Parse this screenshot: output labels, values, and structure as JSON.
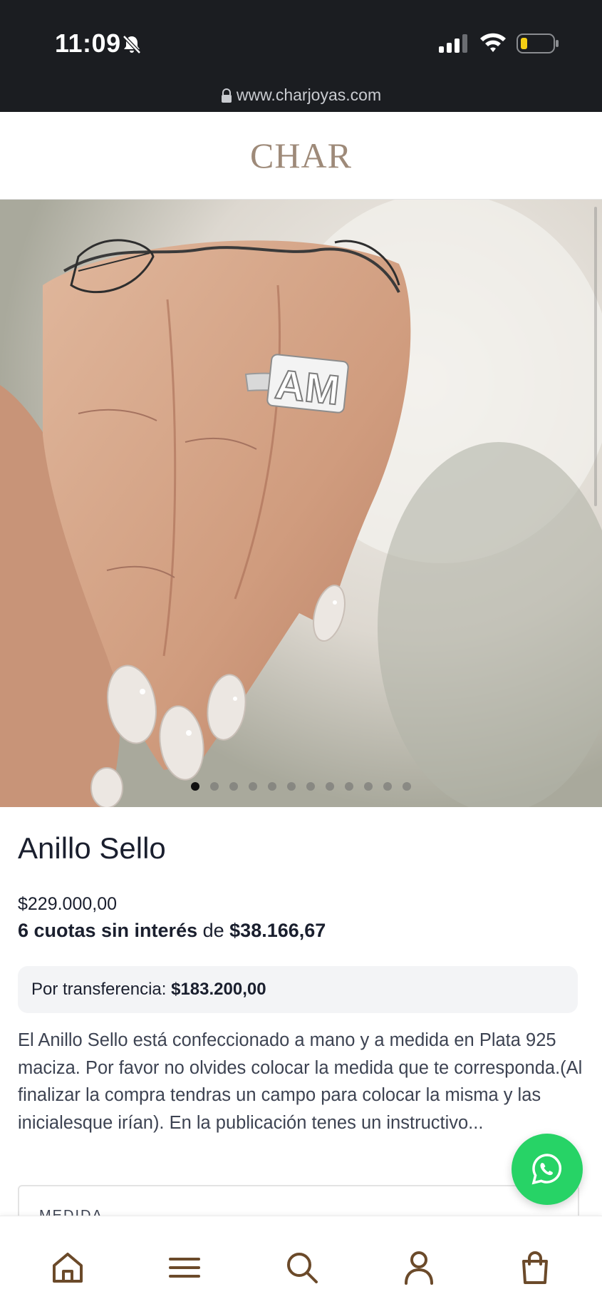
{
  "status_bar": {
    "time": "11:09",
    "url": "www.charjoyas.com"
  },
  "header": {
    "brand": "CHAR"
  },
  "carousel": {
    "total_slides": 12,
    "active_index": 0
  },
  "product": {
    "title": "Anillo Sello",
    "price": "$229.000,00",
    "installments_bold": "6 cuotas sin interés",
    "installments_de": " de ",
    "installments_amount": "$38.166,67",
    "transfer_label": "Por transferencia: ",
    "transfer_price": "$183.200,00",
    "description": "El Anillo Sello está confeccionado a mano y a medida en Plata 925 maciza. Por favor no olvides colocar la medida que te corresponda.(Al finalizar la compra tendras un campo para colocar la misma y las inicialesque irían).  En la publicación tenes un instructivo...",
    "size_label": "MEDIDA"
  },
  "image_text": "AM",
  "colors": {
    "accent": "#27d366",
    "nav_icon": "#6b4a2a",
    "brand": "#9e8a79"
  },
  "bottom_nav": [
    "home-icon",
    "menu-icon",
    "search-icon",
    "account-icon",
    "cart-icon"
  ]
}
